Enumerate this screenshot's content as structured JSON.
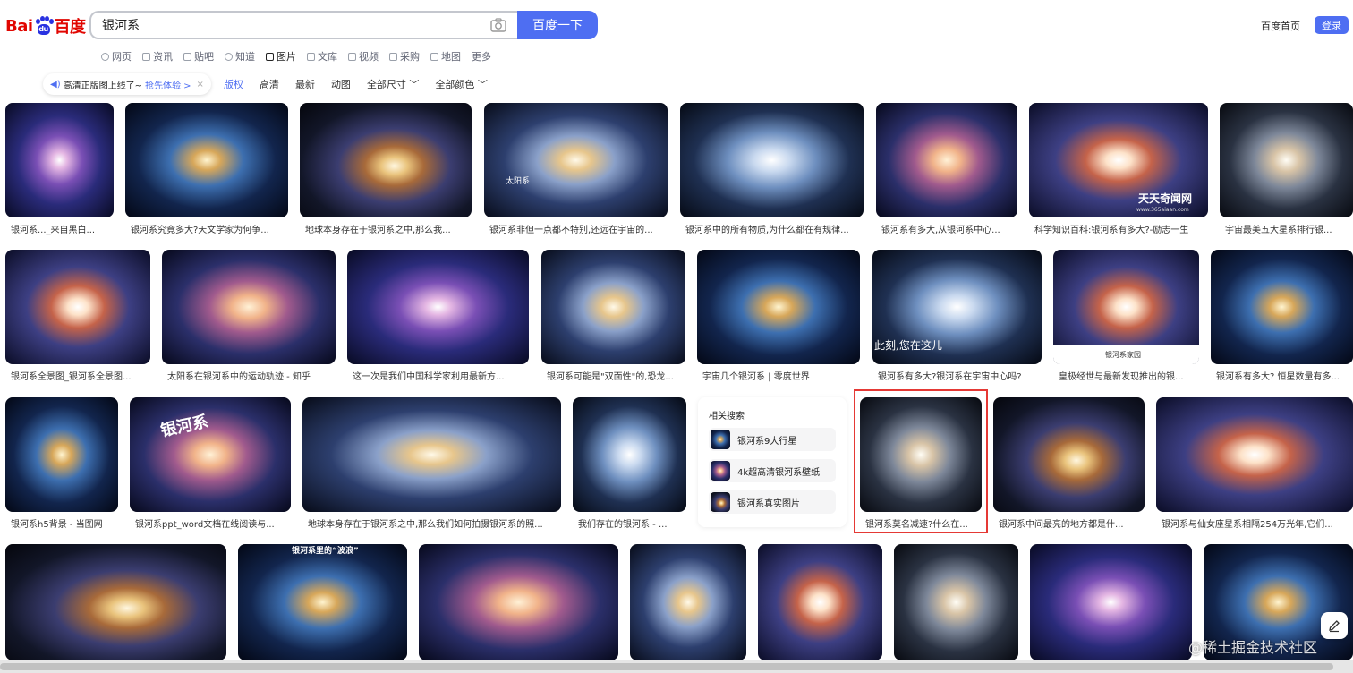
{
  "header": {
    "logo_text_left": "Bai",
    "logo_paw_text": "du",
    "logo_text_right": "百度",
    "search_value": "银河系",
    "search_button": "百度一下",
    "home_link": "百度首页",
    "login_button": "登录"
  },
  "tabs": [
    {
      "label": "网页",
      "icon": "search-icon",
      "active": false
    },
    {
      "label": "资讯",
      "icon": "news-icon",
      "active": false
    },
    {
      "label": "贴吧",
      "icon": "tieba-icon",
      "active": false
    },
    {
      "label": "知道",
      "icon": "question-icon",
      "active": false
    },
    {
      "label": "图片",
      "icon": "image-icon",
      "active": true
    },
    {
      "label": "文库",
      "icon": "doc-icon",
      "active": false
    },
    {
      "label": "视频",
      "icon": "video-icon",
      "active": false
    },
    {
      "label": "采购",
      "icon": "cart-icon",
      "active": false
    },
    {
      "label": "地图",
      "icon": "map-icon",
      "active": false
    },
    {
      "label": "更多",
      "icon": "",
      "active": false
    }
  ],
  "filters": {
    "promo_text": "高清正版图上线了~",
    "promo_link": "抢先体验 >",
    "promo_close": "×",
    "items": [
      "版权",
      "高清",
      "最新",
      "动图",
      "全部尺寸 ﹀",
      "全部颜色 ﹀"
    ]
  },
  "rows": [
    [
      {
        "caption": "银河系..._来自黑白..."
      },
      {
        "caption": "银河系究竟多大?天文学家为何争..."
      },
      {
        "caption": "地球本身存在于银河系之中,那么我..."
      },
      {
        "caption": "银河系非但一点都不特别,还远在宇宙的..."
      },
      {
        "caption": "银河系中的所有物质,为什么都在有规律..."
      },
      {
        "caption": "银河系有多大,从银河系中心..."
      },
      {
        "caption": "科学知识百科:银河系有多大?-励志一生"
      },
      {
        "caption": "宇宙最美五大星系排行银..."
      }
    ],
    [
      {
        "caption": "银河系全景图_银河系全景图..."
      },
      {
        "caption": "太阳系在银河系中的运动轨迹 - 知乎"
      },
      {
        "caption": "这一次是我们中国科学家利用最新方..."
      },
      {
        "caption": "银河系可能是\"双面性\"的,恐龙..."
      },
      {
        "caption": "宇宙几个银河系 | 零度世界"
      },
      {
        "caption": "银河系有多大?银河系在宇宙中心吗?"
      },
      {
        "caption": "皇极经世与最新发现推出的银..."
      },
      {
        "caption": "银河系有多大? 恒星数量有多..."
      }
    ],
    [
      {
        "caption": "银河系h5背景 - 当图网"
      },
      {
        "caption": "银河系ppt_word文档在线阅读与..."
      },
      {
        "caption": "地球本身存在于银河系之中,那么我们如何拍摄银河系的照..."
      },
      {
        "caption": "我们存在的银河系 - ..."
      },
      {
        "caption": "银河系莫名减速?什么在..."
      },
      {
        "caption": "银河系中间最亮的地方都是什..."
      },
      {
        "caption": "银河系与仙女座星系相隔254万光年,它们..."
      }
    ]
  ],
  "image_overlays": {
    "sun_label": "太阳系",
    "here_label": "此刻,您在这儿",
    "site_label": "天天奇闻网",
    "site_url": "www.365aiaan.com",
    "family_label": "银河系家园",
    "ppt_label": "银河系",
    "wave_label": "银河系里的“波浪”"
  },
  "related": {
    "title": "相关搜索",
    "items": [
      "银河系9大行星",
      "4k超高清银河系壁纸",
      "银河系真实图片"
    ]
  },
  "watermark": "@稀土掘金技术社区"
}
